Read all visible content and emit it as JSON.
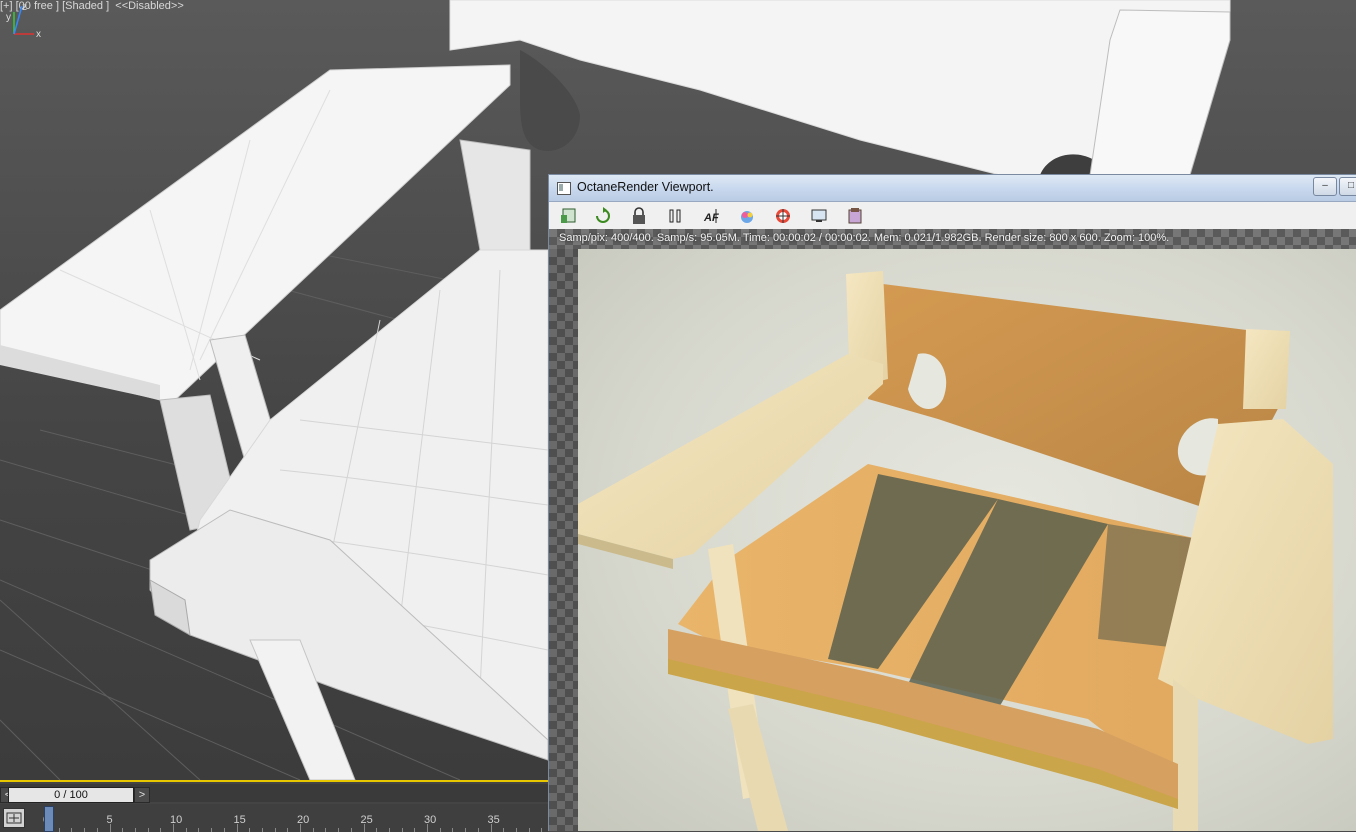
{
  "viewport": {
    "label": "[+] [00 free ] [Shaded ]  <<Disabled>>",
    "axis": {
      "x": "x",
      "y": "y",
      "z": "z"
    }
  },
  "timeslider": {
    "frame": "0 / 100",
    "prev": "<",
    "next": ">",
    "ticks": [
      "0",
      "5",
      "10",
      "15",
      "20",
      "25",
      "30",
      "35"
    ]
  },
  "octane": {
    "title": "OctaneRender Viewport.",
    "status": "Samp/pix: 400/400.    Samp/s: 95.05M.    Time: 00:00:02 / 00:00:02.    Mem: 0.021/1.982GB.    Render size: 800 x 600.    Zoom: 100%.",
    "toolbar": [
      {
        "name": "save-image-icon"
      },
      {
        "name": "restart-render-icon"
      },
      {
        "name": "lock-icon"
      },
      {
        "name": "pause-icon"
      },
      {
        "name": "af-focus-icon"
      },
      {
        "name": "material-picker-icon"
      },
      {
        "name": "region-render-icon"
      },
      {
        "name": "display-icon"
      },
      {
        "name": "clay-mode-icon"
      }
    ],
    "window_buttons": {
      "minimize": "–",
      "maximize": "□"
    }
  },
  "colors": {
    "leather": "#dca45e",
    "wood": "#f1e2b8",
    "timeline_accent": "#e8c600",
    "titlebar": "#c9d9ee"
  }
}
